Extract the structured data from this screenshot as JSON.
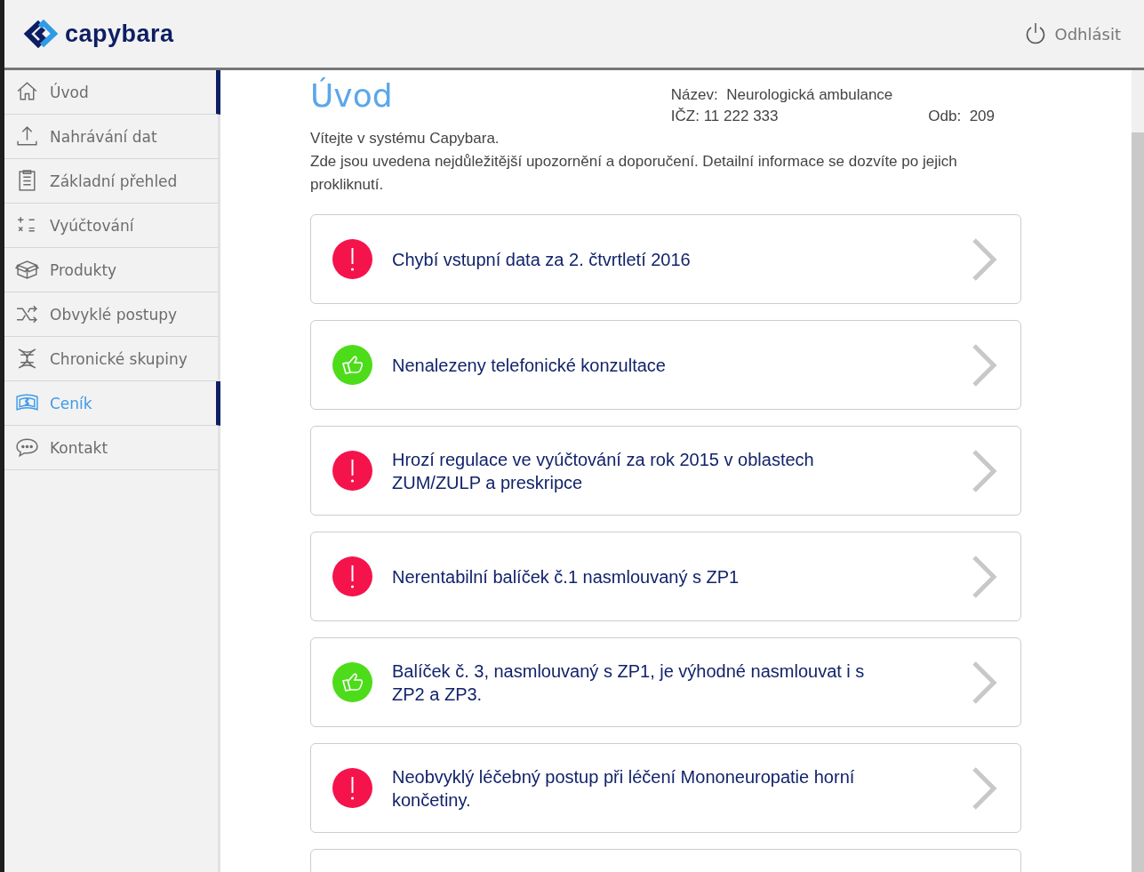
{
  "header": {
    "logo": "capybara",
    "logout": "Odhlásit"
  },
  "sidebar": {
    "items": [
      {
        "label": "Úvod",
        "kind": "home",
        "selected": true,
        "highlighted": false
      },
      {
        "label": "Nahrávání dat",
        "kind": "upload",
        "selected": false,
        "highlighted": false
      },
      {
        "label": "Základní přehled",
        "kind": "clipboard",
        "selected": false,
        "highlighted": false
      },
      {
        "label": "Vyúčtování",
        "kind": "math",
        "selected": false,
        "highlighted": false
      },
      {
        "label": "Produkty",
        "kind": "box",
        "selected": false,
        "highlighted": false
      },
      {
        "label": "Obvyklé postupy",
        "kind": "shuffle",
        "selected": false,
        "highlighted": false
      },
      {
        "label": "Chronické skupiny",
        "kind": "dna",
        "selected": false,
        "highlighted": false
      },
      {
        "label": "Ceník",
        "kind": "money",
        "selected": true,
        "highlighted": true
      },
      {
        "label": "Kontakt",
        "kind": "chat",
        "selected": false,
        "highlighted": false
      }
    ]
  },
  "page": {
    "title": "Úvod",
    "info": {
      "name_label": "Název:",
      "name": "Neurologická ambulance",
      "icz_label": "IČZ:",
      "icz": "11 222 333",
      "odb_label": "Odb:",
      "odb": "209"
    },
    "intro": [
      "Vítejte v systému Capybara.",
      "Zde jsou uvedena nejdůležitější upozornění a doporučení. Detailní informace se dozvíte po jejich prokliknutí."
    ]
  },
  "alerts": [
    {
      "kind": "warning",
      "text": "Chybí vstupní data za 2. čtvrtletí 2016"
    },
    {
      "kind": "ok",
      "text": "Nenalezeny telefonické konzultace"
    },
    {
      "kind": "warning",
      "text": "Hrozí regulace ve vyúčtování za rok 2015 v oblastech ZUM/ZULP a preskripce"
    },
    {
      "kind": "warning",
      "text": "Nerentabilní balíček č.1 nasmlouvaný s ZP1"
    },
    {
      "kind": "ok",
      "text": "Balíček č. 3, nasmlouvaný s ZP1,  je výhodné nasmlouvat i s ZP2 a ZP3."
    },
    {
      "kind": "warning",
      "text": "Neobvyklý léčebný postup při léčení Mononeuropatie horní končetiny."
    }
  ]
}
